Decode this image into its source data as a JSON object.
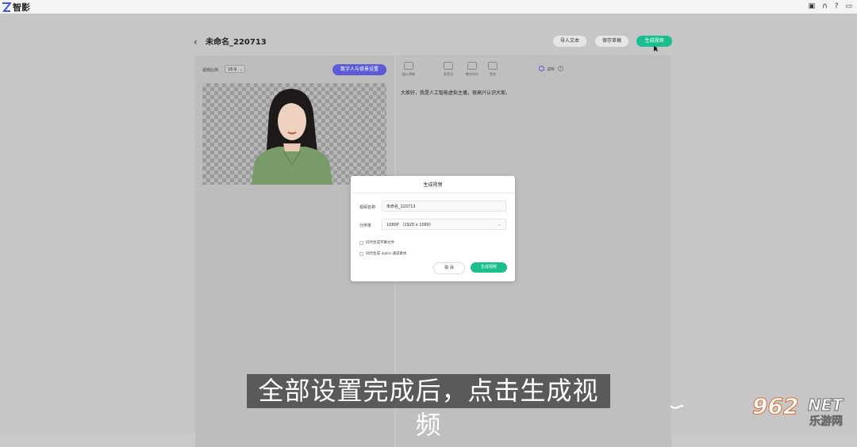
{
  "app": {
    "name": "智影"
  },
  "window_controls": [
    {
      "name": "delete-icon",
      "glyph": "▣"
    },
    {
      "name": "headset-icon",
      "glyph": "∩"
    },
    {
      "name": "help-icon",
      "glyph": "?"
    },
    {
      "name": "message-icon",
      "glyph": "▭"
    }
  ],
  "project": {
    "back_glyph": "‹",
    "title": "未命名_220713"
  },
  "top_actions": {
    "import_text": "导入文本",
    "save_draft": "保存草稿",
    "generate_video": "生成视频"
  },
  "left_panel": {
    "ratio_label": "视频比例",
    "ratio_value": "16:9",
    "bg_settings_label": "数字人与背景设置"
  },
  "right_panel": {
    "toolbar": [
      {
        "icon": "import-icon",
        "label": "插入停顿"
      },
      {
        "icon": "polyphone-icon",
        "label": "多音字"
      },
      {
        "icon": "number-icon",
        "label": "数字符号"
      },
      {
        "icon": "note-icon",
        "label": "别名"
      }
    ],
    "voice_label": "",
    "play_label": "试听",
    "script": "大家好，我是人工智能虚拟主播，很高兴认识大家。"
  },
  "modal": {
    "title": "生成视频",
    "name_label": "视频名称",
    "name_value": "未命名_220713",
    "resolution_label": "分辨率",
    "resolution_value": "1080P （1920 x 1080）",
    "option_subtitle": "同时生成字幕文件",
    "option_alpha": "同时生成 alpha 通道素材",
    "cancel_label": "取 消",
    "generate_label": "生成视频"
  },
  "caption": "全部设置完成后，点击生成视频",
  "watermark": {
    "number": "962",
    "suffix": "NET",
    "site": "乐游网"
  },
  "colors": {
    "accent_green": "#1bbf8f",
    "accent_purple": "#5b5bd6",
    "overlay_gray": "#c6c6c6"
  }
}
